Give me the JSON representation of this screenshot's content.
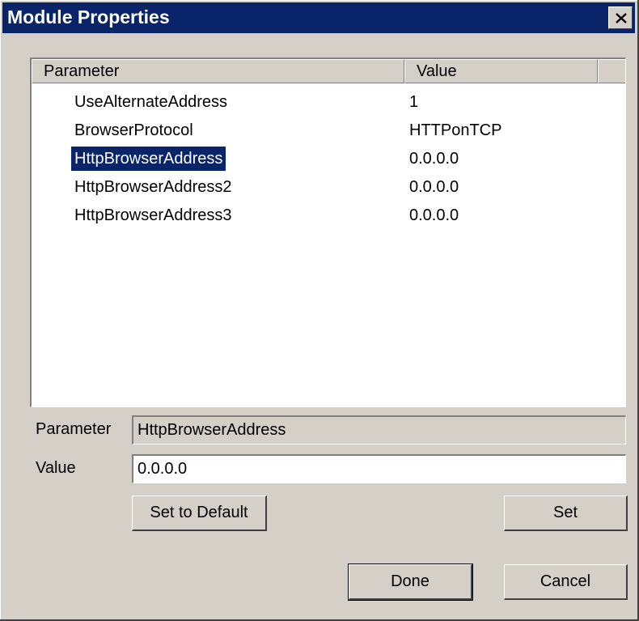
{
  "window": {
    "title": "Module Properties",
    "close_label": "✕"
  },
  "list": {
    "columns": [
      "Parameter",
      "Value"
    ],
    "rows": [
      {
        "parameter": "UseAlternateAddress",
        "value": "1"
      },
      {
        "parameter": "BrowserProtocol",
        "value": "HTTPonTCP"
      },
      {
        "parameter": "HttpBrowserAddress",
        "value": "0.0.0.0",
        "selected": true
      },
      {
        "parameter": "HttpBrowserAddress2",
        "value": "0.0.0.0"
      },
      {
        "parameter": "HttpBrowserAddress3",
        "value": "0.0.0.0"
      }
    ]
  },
  "form": {
    "parameter_label": "Parameter",
    "parameter_value": "HttpBrowserAddress",
    "value_label": "Value",
    "value_value": "0.0.0.0"
  },
  "buttons": {
    "set_to_default": "Set to Default",
    "set": "Set",
    "done": "Done",
    "cancel": "Cancel"
  },
  "colors": {
    "title_bar": "#0a246a",
    "selection": "#0a246a",
    "face": "#d4d0c8"
  }
}
